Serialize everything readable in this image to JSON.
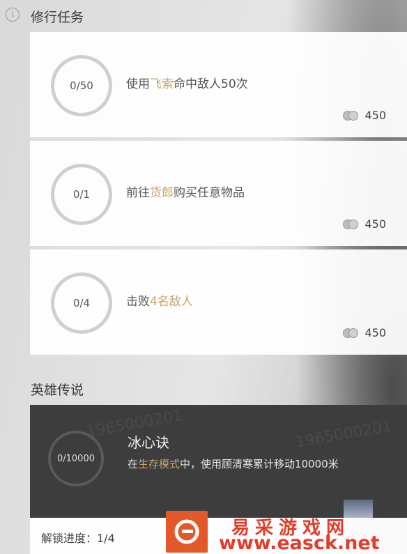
{
  "sections": {
    "daily": "修行任务",
    "legend": "英雄传说"
  },
  "tasks": [
    {
      "progress": "0/50",
      "desc_pre": "使用",
      "desc_hl": "飞索",
      "desc_post": "命中敌人50次",
      "reward": "450"
    },
    {
      "progress": "0/1",
      "desc_pre": "前往",
      "desc_hl": "货郎",
      "desc_post": "购买任意物品",
      "reward": "450"
    },
    {
      "progress": "0/4",
      "desc_pre": "击败",
      "desc_hl": "4名敌人",
      "desc_post": "",
      "reward": "450"
    }
  ],
  "hero": {
    "progress": "0/10000",
    "title": "冰心诀",
    "desc_pre": "在",
    "desc_hl": "生存模式",
    "desc_post": "中，使用顾清寒累计移动10000米",
    "watermark": "1965000201"
  },
  "unlock": {
    "text": "解锁进度：1/4"
  },
  "site": {
    "title": "易采游戏网",
    "url": "www.easck.net"
  },
  "colors": {
    "highlight": "#c9a36a",
    "brand": "#e23c2b"
  }
}
